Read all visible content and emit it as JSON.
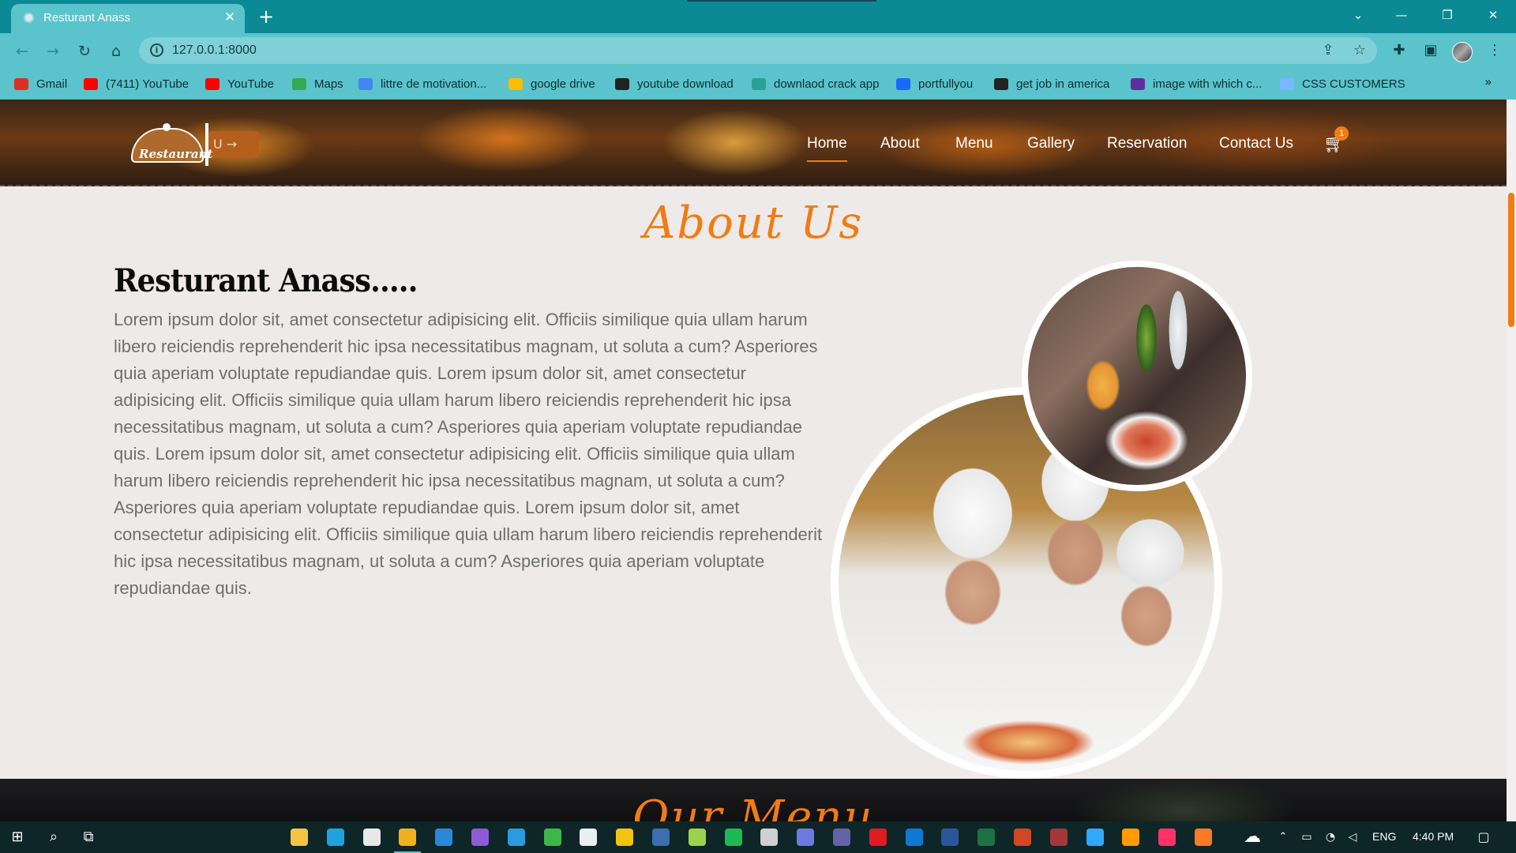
{
  "browser": {
    "tab_title": "Resturant Anass",
    "close_glyph": "✕",
    "new_tab_glyph": "+",
    "url": "127.0.0.1:8000",
    "window_controls": {
      "dropdown": "⌄",
      "minimize": "—",
      "restore": "❐",
      "close": "✕"
    },
    "bookmarks": [
      {
        "label": "Gmail",
        "icon": "gmail-icon",
        "color": "#d93025"
      },
      {
        "label": "(7411) YouTube",
        "icon": "youtube-icon",
        "color": "#ff0000"
      },
      {
        "label": "YouTube",
        "icon": "youtube-icon",
        "color": "#ff0000"
      },
      {
        "label": "Maps",
        "icon": "maps-icon",
        "color": "#34a853"
      },
      {
        "label": "littre de motivation...",
        "icon": "docs-icon",
        "color": "#4285f4"
      },
      {
        "label": "google drive",
        "icon": "drive-icon",
        "color": "#fbbc04"
      },
      {
        "label": "youtube download",
        "icon": "globe-icon",
        "color": "#222222"
      },
      {
        "label": "downlaod crack app",
        "icon": "app-icon",
        "color": "#2aa198"
      },
      {
        "label": "portfullyou",
        "icon": "behance-icon",
        "color": "#1769ff"
      },
      {
        "label": "get job in america",
        "icon": "globe-icon",
        "color": "#222222"
      },
      {
        "label": "image with which c...",
        "icon": "image-icon",
        "color": "#5b2fa0"
      },
      {
        "label": "CSS CUSTOMERS",
        "icon": "css-icon",
        "color": "#7ab7ff"
      }
    ],
    "more_bookmarks": "»"
  },
  "site": {
    "logo_text": "Restaurant",
    "logo_tag": "U →",
    "nav": [
      "Home",
      "About",
      "Menu",
      "Gallery",
      "Reservation",
      "Contact Us"
    ],
    "active_nav": "Home",
    "cart_count": "1",
    "about": {
      "section_title": "About Us",
      "heading": "Resturant Anass.....",
      "body": "Lorem ipsum dolor sit, amet consectetur adipisicing elit. Officiis similique quia ullam harum libero reiciendis reprehenderit hic ipsa necessitatibus magnam, ut soluta a cum? Asperiores quia aperiam voluptate repudiandae quis. Lorem ipsum dolor sit, amet consectetur adipisicing elit. Officiis similique quia ullam harum libero reiciendis reprehenderit hic ipsa necessitatibus magnam, ut soluta a cum? Asperiores quia aperiam voluptate repudiandae quis. Lorem ipsum dolor sit, amet consectetur adipisicing elit. Officiis similique quia ullam harum libero reiciendis reprehenderit hic ipsa necessitatibus magnam, ut soluta a cum? Asperiores quia aperiam voluptate repudiandae quis. Lorem ipsum dolor sit, amet consectetur adipisicing elit. Officiis similique quia ullam harum libero reiciendis reprehenderit hic ipsa necessitatibus magnam, ut soluta a cum? Asperiores quia aperiam voluptate repudiandae quis."
    },
    "menu_section_title": "Our Menu",
    "accent_color": "#f07c15"
  },
  "taskbar": {
    "apps": [
      {
        "name": "file-explorer-icon",
        "color": "#f4c542"
      },
      {
        "name": "edge-icon",
        "color": "#1fa3e0"
      },
      {
        "name": "store-icon",
        "color": "#e8e8e8"
      },
      {
        "name": "chrome-icon",
        "color": "#f2b01e"
      },
      {
        "name": "mail-icon",
        "color": "#2b88d8"
      },
      {
        "name": "visual-studio-icon",
        "color": "#8e5bd6"
      },
      {
        "name": "vscode-icon",
        "color": "#2a9bdf"
      },
      {
        "name": "xbox-icon",
        "color": "#3db64a"
      },
      {
        "name": "wordpress-icon",
        "color": "#e9eef2"
      },
      {
        "name": "layers-icon",
        "color": "#f1c40f"
      },
      {
        "name": "image-app-icon",
        "color": "#3a6fb0"
      },
      {
        "name": "notepad-icon",
        "color": "#9bd24b"
      },
      {
        "name": "spotify-icon",
        "color": "#1db954"
      },
      {
        "name": "epic-games-icon",
        "color": "#d0d0d0"
      },
      {
        "name": "discord-icon",
        "color": "#6c7ae0"
      },
      {
        "name": "teams-icon",
        "color": "#6264a7"
      },
      {
        "name": "opera-icon",
        "color": "#e01b24"
      },
      {
        "name": "outlook-icon",
        "color": "#0f78d4"
      },
      {
        "name": "word-icon",
        "color": "#2b579a"
      },
      {
        "name": "excel-icon",
        "color": "#1e7145"
      },
      {
        "name": "powerpoint-icon",
        "color": "#d24726"
      },
      {
        "name": "access-icon",
        "color": "#a4373a"
      },
      {
        "name": "photoshop-icon",
        "color": "#31a8ff"
      },
      {
        "name": "illustrator-icon",
        "color": "#ff9a00"
      },
      {
        "name": "indesign-icon",
        "color": "#ff3366"
      },
      {
        "name": "xampp-icon",
        "color": "#fb7a24"
      }
    ],
    "language": "ENG",
    "time": "4:40 PM"
  }
}
